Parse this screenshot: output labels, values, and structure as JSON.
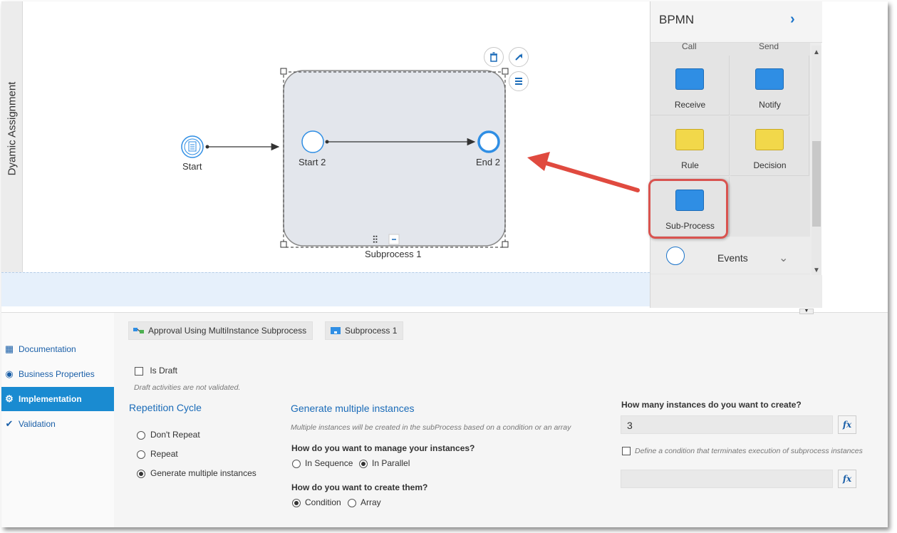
{
  "lane": {
    "label": "Dyamic Assignment"
  },
  "diagram": {
    "start_label": "Start",
    "start2_label": "Start 2",
    "end2_label": "End 2",
    "subprocess_label": "Subprocess 1"
  },
  "palette": {
    "title": "BPMN",
    "partial_items": [
      "Call",
      "Send"
    ],
    "items": [
      {
        "label": "Receive",
        "icon": "receive-icon",
        "color": "#2f8ee4"
      },
      {
        "label": "Notify",
        "icon": "notify-icon",
        "color": "#2f8ee4"
      },
      {
        "label": "Rule",
        "icon": "rule-icon",
        "color": "#f2d84a"
      },
      {
        "label": "Decision",
        "icon": "decision-icon",
        "color": "#f2d84a"
      },
      {
        "label": "Sub-Process",
        "icon": "subprocess-icon",
        "color": "#2f8ee4"
      }
    ],
    "events_label": "Events"
  },
  "nav": {
    "items": [
      {
        "label": "Documentation",
        "icon": "documentation-icon"
      },
      {
        "label": "Business Properties",
        "icon": "business-properties-icon"
      },
      {
        "label": "Implementation",
        "icon": "gear-icon",
        "active": true
      },
      {
        "label": "Validation",
        "icon": "checkmark-icon"
      }
    ]
  },
  "breadcrumb": {
    "process": "Approval Using MultiInstance Subprocess",
    "subprocess": "Subprocess 1"
  },
  "props": {
    "is_draft_label": "Is Draft",
    "draft_hint": "Draft activities are not validated.",
    "repetition_title": "Repetition Cycle",
    "repetition_options": [
      "Don't Repeat",
      "Repeat",
      "Generate multiple instances"
    ],
    "multi_title": "Generate multiple instances",
    "multi_hint": "Multiple instances will be created in the subProcess based on a condition or an array",
    "manage_question": "How do you want to manage your instances?",
    "manage_options": [
      "In Sequence",
      "In Parallel"
    ],
    "create_question": "How do you want to create them?",
    "create_options": [
      "Condition",
      "Array"
    ],
    "count_question": "How many instances do you want to create?",
    "count_value": "3",
    "terminate_label": "Define a condition that terminates execution of subprocess instances",
    "fx_label": "fx"
  },
  "colors": {
    "accent": "#1a8bd1",
    "highlight": "#d9534f",
    "subprocess_fill": "#e3e6ec"
  }
}
